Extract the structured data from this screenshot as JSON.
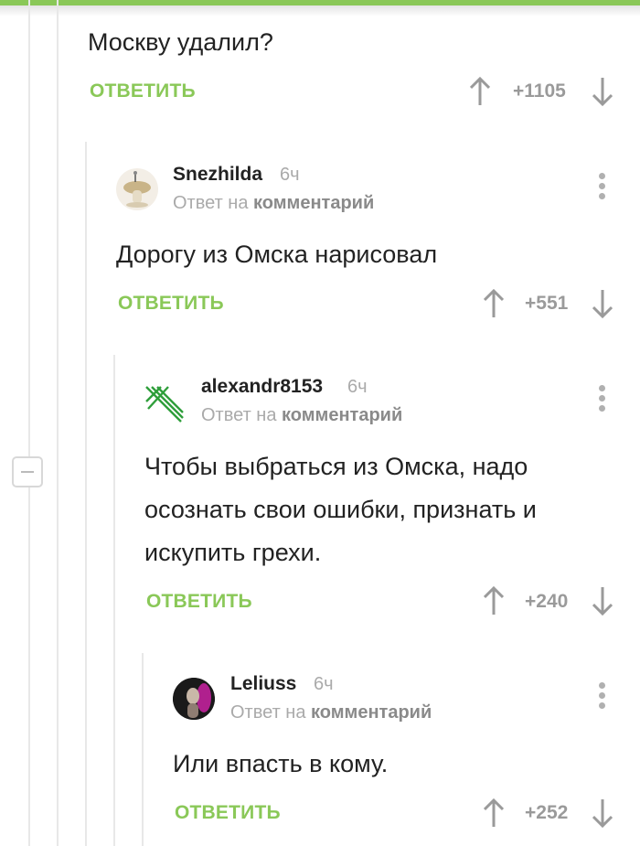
{
  "comments": [
    {
      "text": "Москву удалил?",
      "reply_label": "ОТВЕТИТЬ",
      "score": "+1105"
    },
    {
      "author": "Snezhilda",
      "time": "6ч",
      "reply_to_prefix": "Ответ на",
      "reply_to_link": "комментарий",
      "text": "Дорогу из Омска нарисовал",
      "reply_label": "ОТВЕТИТЬ",
      "score": "+551"
    },
    {
      "author": "alexandr8153",
      "time": "6ч",
      "reply_to_prefix": "Ответ на",
      "reply_to_link": "комментарий",
      "text_lines": [
        "Чтобы выбраться из Омска, надо",
        "осознать свои ошибки, признать и",
        "искупить грехи."
      ],
      "reply_label": "ОТВЕТИТЬ",
      "score": "+240"
    },
    {
      "author": "Leliuss",
      "time": "6ч",
      "reply_to_prefix": "Ответ на",
      "reply_to_link": "комментарий",
      "text": "Или впасть в кому.",
      "reply_label": "ОТВЕТИТЬ",
      "score": "+252"
    }
  ],
  "colors": {
    "accent": "#8ac858",
    "text": "#222222",
    "muted": "#aaaaaa",
    "score": "#9a9a9a",
    "thread_line": "#e8e8e8"
  },
  "icons": {
    "upvote": "arrow-up-icon",
    "downvote": "arrow-down-icon",
    "menu": "more-vertical-icon",
    "collapse": "minus-icon"
  }
}
